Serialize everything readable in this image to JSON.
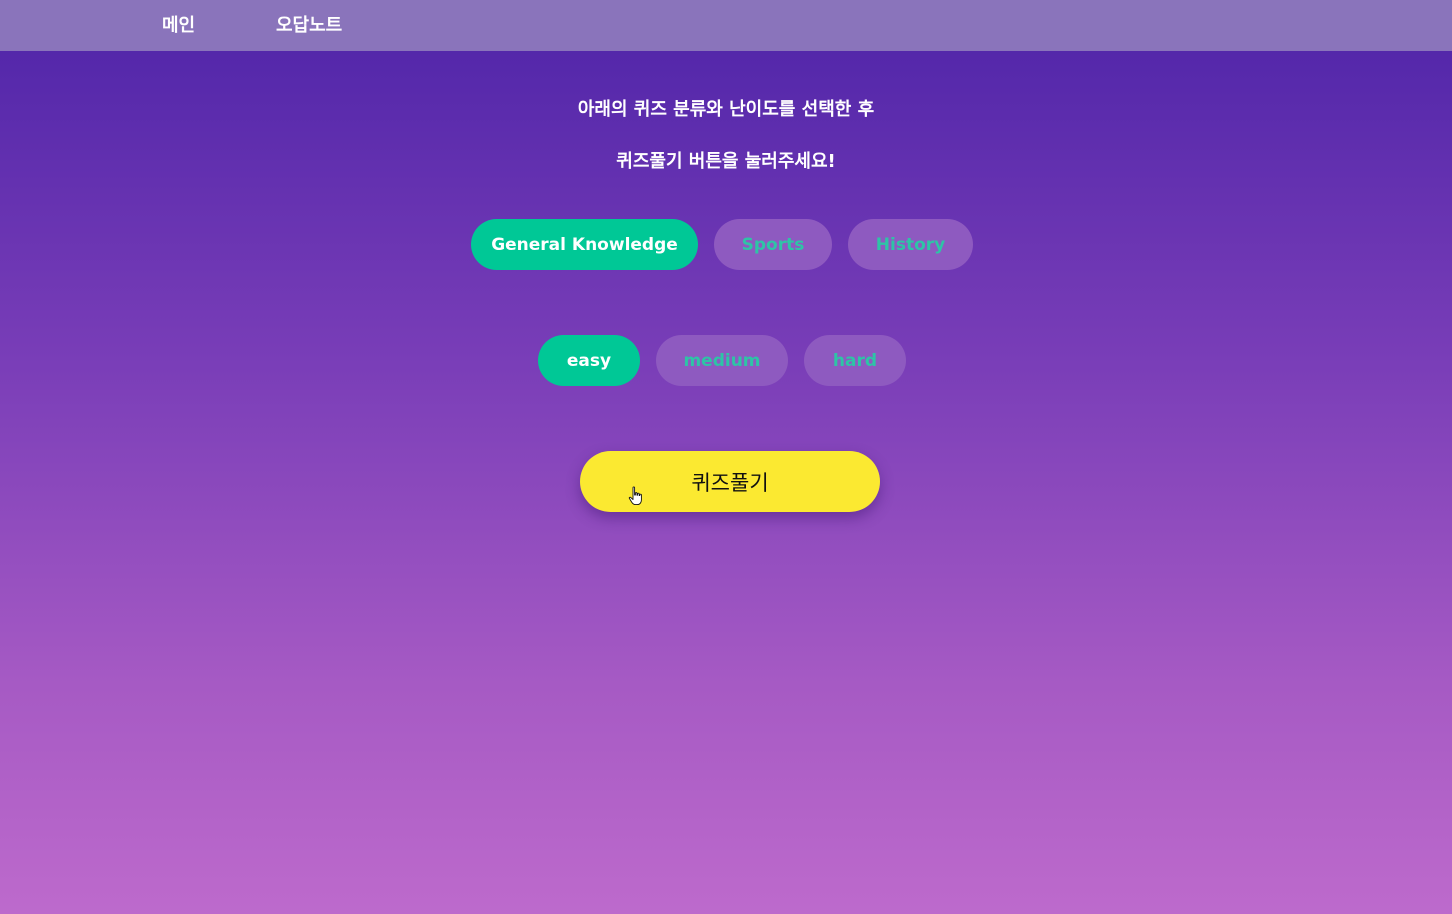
{
  "nav": {
    "items": [
      {
        "label": "메인"
      },
      {
        "label": "오답노트"
      }
    ]
  },
  "instructions": {
    "line1": "아래의 퀴즈 분류와 난이도를 선택한 후",
    "line2": "퀴즈풀기 버튼을 눌러주세요!"
  },
  "categories": [
    {
      "label": "General Knowledge",
      "selected": true
    },
    {
      "label": "Sports",
      "selected": false
    },
    {
      "label": "History",
      "selected": false
    }
  ],
  "difficulties": [
    {
      "label": "easy",
      "selected": true
    },
    {
      "label": "medium",
      "selected": false
    },
    {
      "label": "hard",
      "selected": false
    }
  ],
  "start_button": {
    "label": "퀴즈풀기"
  },
  "colors": {
    "nav_background": "#8a74bb",
    "active_pill": "#00c896",
    "inactive_pill": "#8e5ac0",
    "inactive_text": "#2ec4a6",
    "start_button": "#fbe931"
  },
  "icons": {
    "cursor": "hand-pointer-icon"
  }
}
